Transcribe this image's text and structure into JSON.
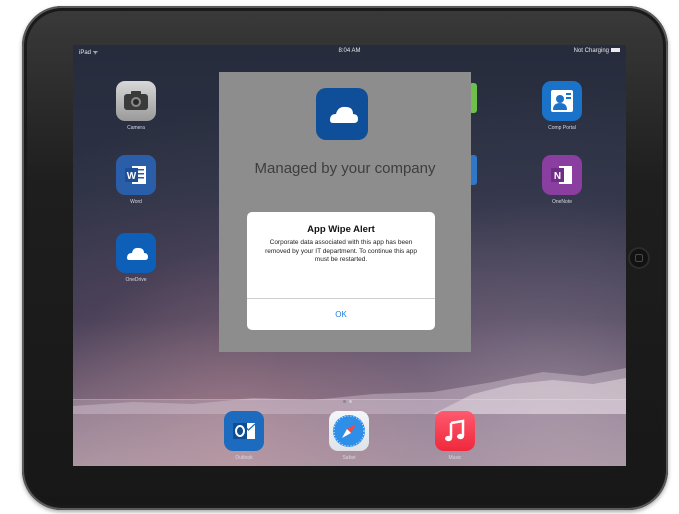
{
  "status_bar": {
    "carrier": "iPad ᯤ",
    "time": "8:04 AM",
    "battery": "Not Charging"
  },
  "home_apps": [
    {
      "name": "Camera",
      "icon": "camera-icon"
    },
    {
      "name": "Word",
      "icon": "word-icon"
    },
    {
      "name": "OneDrive",
      "icon": "onedrive-icon"
    },
    {
      "name": "Comp Portal",
      "icon": "company-portal-icon"
    },
    {
      "name": "OneNote",
      "icon": "onenote-icon"
    }
  ],
  "dock_apps": [
    {
      "name": "Outlook",
      "icon": "outlook-icon"
    },
    {
      "name": "Safari",
      "icon": "safari-icon"
    },
    {
      "name": "Music",
      "icon": "music-icon"
    }
  ],
  "managed_screen": {
    "app_icon": "onedrive-icon",
    "title": "Managed by your company"
  },
  "alert": {
    "title": "App Wipe Alert",
    "message": "Corporate data associated with this app has been removed by your IT department. To continue this app must be restarted.",
    "ok_label": "OK"
  },
  "colors": {
    "overlay": "#8d8d8d",
    "alert_button": "#1f7ae0",
    "onedrive_blue": "#0f4f9a"
  }
}
